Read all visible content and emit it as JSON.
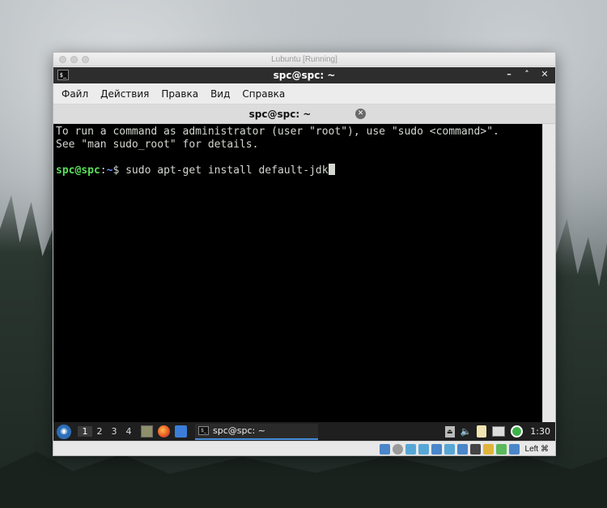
{
  "vbox": {
    "title": "Lubuntu [Running]",
    "host_key": "Left ⌘"
  },
  "terminal_window": {
    "title": "spc@spc: ~",
    "app_icon": "terminal-icon",
    "controls": [
      "minimize-icon",
      "maximize-icon",
      "close-icon"
    ]
  },
  "menubar": {
    "items": [
      "Файл",
      "Действия",
      "Правка",
      "Вид",
      "Справка"
    ]
  },
  "tab": {
    "label": "spc@spc: ~"
  },
  "terminal": {
    "line1": "To run a command as administrator (user \"root\"), use \"sudo <command>\".",
    "line2": "See \"man sudo_root\" for details.",
    "prompt_user": "spc@spc",
    "prompt_sep": ":",
    "prompt_path": "~",
    "prompt_symbol": "$ ",
    "command": "sudo apt-get install default-jdk"
  },
  "taskbar": {
    "desktops": [
      "1",
      "2",
      "3",
      "4"
    ],
    "active_desktop": "1",
    "task_label": "spc@spc: ~",
    "clock": "1:30"
  },
  "colors": {
    "prompt_user": "#5ae05a",
    "prompt_path": "#6b8cff",
    "terminal_bg": "#000000",
    "terminal_fg": "#d3d7cf"
  }
}
